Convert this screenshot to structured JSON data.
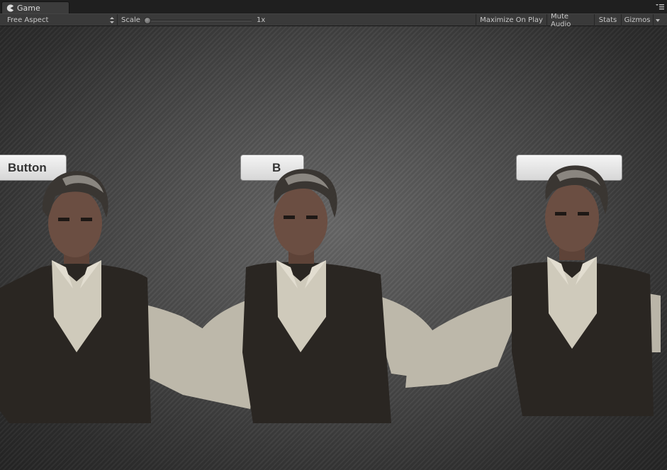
{
  "window": {
    "tab_label": "Game",
    "tab_icon": "pacman-icon",
    "menu_icon": "panel-menu-icon"
  },
  "toolbar": {
    "aspect_label": "Free Aspect",
    "scale_label": "Scale",
    "scale_value": "1x",
    "scale_fraction": 0.0,
    "maximize_label": "Maximize On Play",
    "mute_label": "Mute Audio",
    "stats_label": "Stats",
    "gizmos_label": "Gizmos"
  },
  "viewport": {
    "buttons": [
      {
        "label": "Button"
      },
      {
        "label": "B"
      },
      {
        "label": ""
      }
    ],
    "characters": [
      {
        "description_icon": "character-model"
      },
      {
        "description_icon": "character-model"
      },
      {
        "description_icon": "character-model"
      }
    ]
  },
  "colors": {
    "editor_bg": "#1e1e1e",
    "toolbar_bg": "#3a3a3a",
    "button_face": "#e6e6e6",
    "shirt": "#c9c4b6",
    "vest": "#2a2622",
    "skin": "#6b4e42",
    "hair": "#3a3632"
  }
}
